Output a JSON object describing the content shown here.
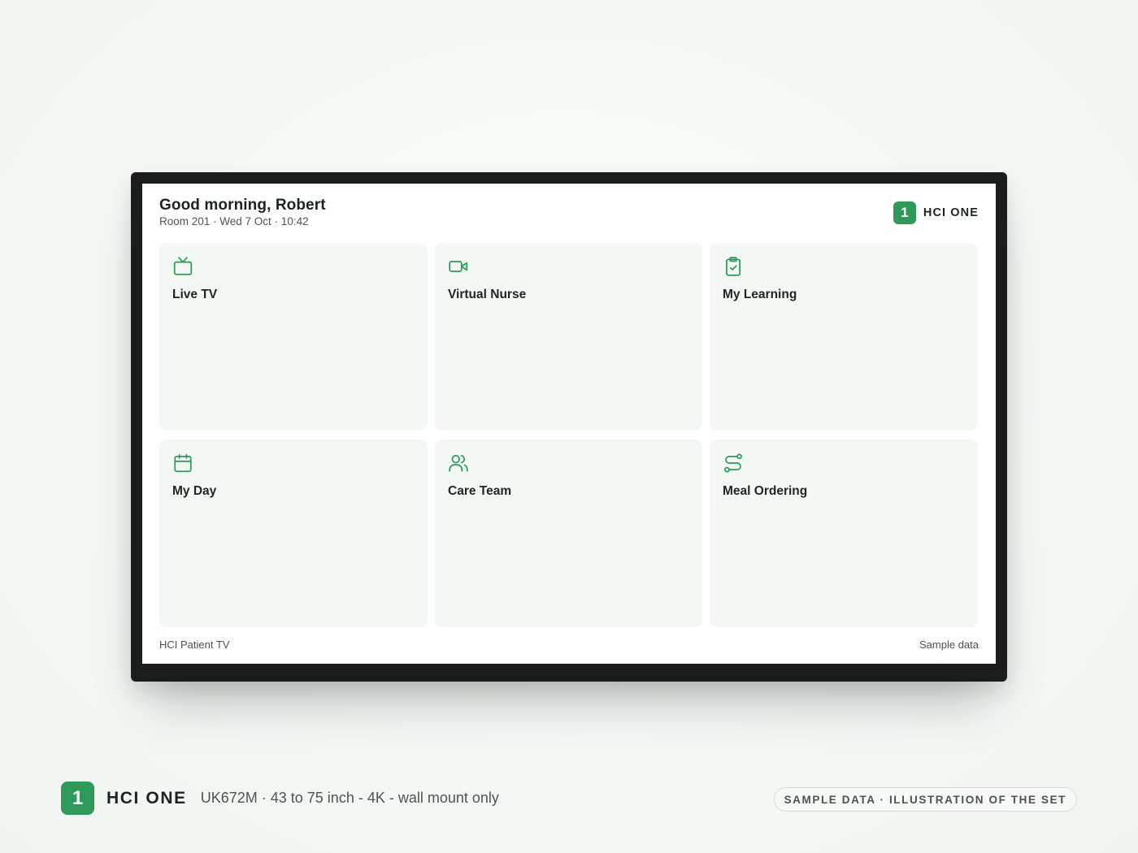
{
  "screen": {
    "greeting": "Good morning, Robert",
    "subline": "Room 201 · Wed 7 Oct · 10:42",
    "brand": {
      "badge": "1",
      "name": "HCI ONE"
    },
    "tiles": [
      {
        "label": "Live TV",
        "icon": "tv-icon"
      },
      {
        "label": "Virtual Nurse",
        "icon": "video-camera-icon"
      },
      {
        "label": "My Learning",
        "icon": "clipboard-check-icon"
      },
      {
        "label": "My Day",
        "icon": "calendar-icon"
      },
      {
        "label": "Care Team",
        "icon": "users-icon"
      },
      {
        "label": "Meal Ordering",
        "icon": "route-icon"
      }
    ],
    "footer_left": "HCI Patient TV",
    "footer_right": "Sample data"
  },
  "caption": {
    "badge": "1",
    "name": "HCI ONE",
    "spec": "UK672M · 43 to 75 inch - 4K - wall mount only",
    "pill": "SAMPLE DATA · ILLUSTRATION OF THE SET"
  },
  "colors": {
    "accent": "#2e9a59",
    "tile_bg": "#f4f8f5",
    "frame": "#1b1c1c",
    "page_bg": "#f5f8f5"
  }
}
